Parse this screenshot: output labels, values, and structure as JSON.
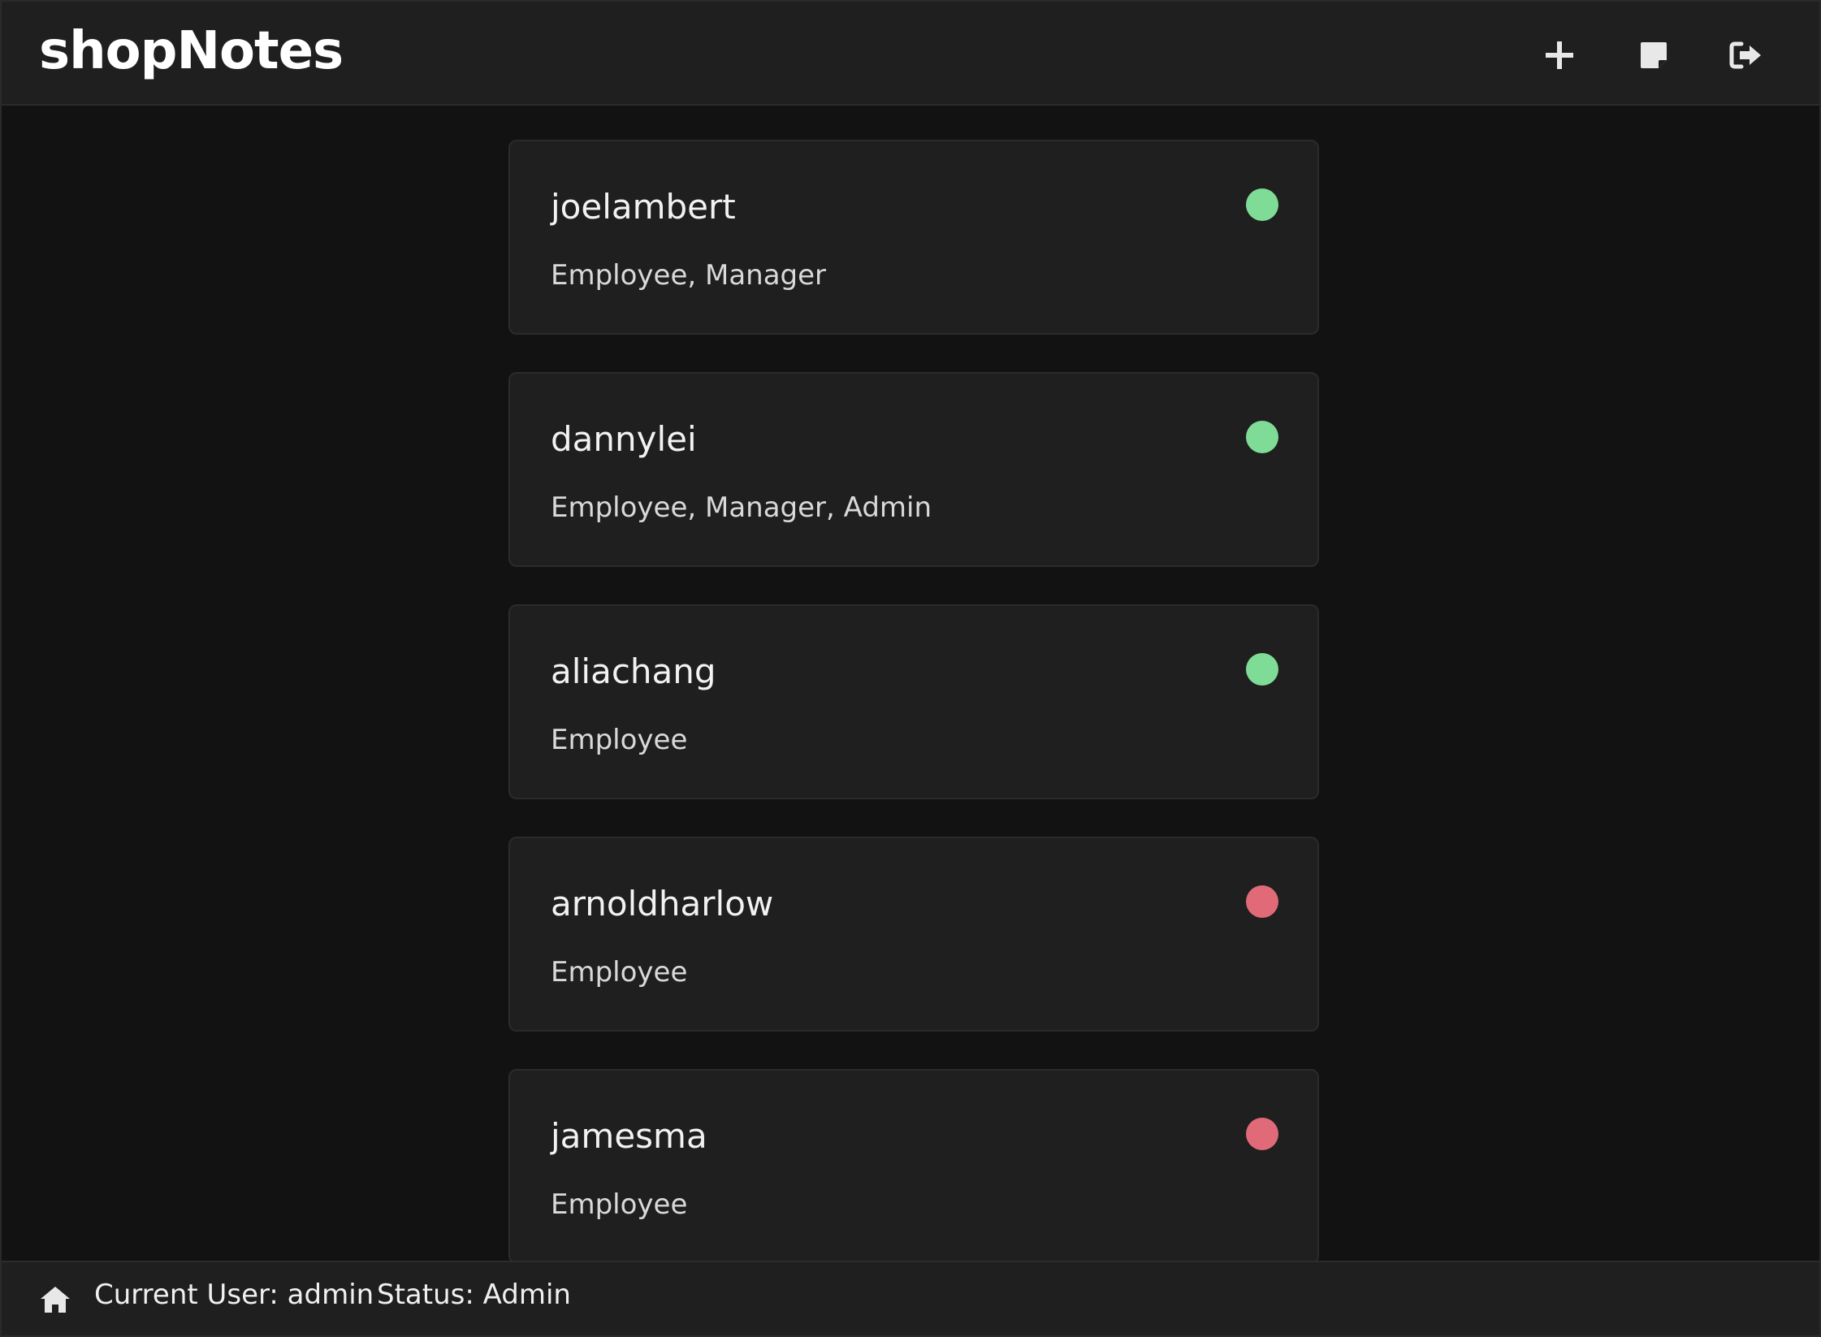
{
  "header": {
    "title": "shopNotes",
    "actions": [
      {
        "icon": "plus-icon",
        "name": "add-user-button"
      },
      {
        "icon": "note-icon",
        "name": "notes-button"
      },
      {
        "icon": "logout-icon",
        "name": "logout-button"
      }
    ]
  },
  "users": [
    {
      "username": "joelambert",
      "roles": "Employee, Manager",
      "status": "active",
      "status_color": "#7fdc96"
    },
    {
      "username": "dannylei",
      "roles": "Employee, Manager, Admin",
      "status": "active",
      "status_color": "#7fdc96"
    },
    {
      "username": "aliachang",
      "roles": "Employee",
      "status": "active",
      "status_color": "#7fdc96"
    },
    {
      "username": "arnoldharlow",
      "roles": "Employee",
      "status": "inactive",
      "status_color": "#e06a78"
    },
    {
      "username": "jamesma",
      "roles": "Employee",
      "status": "inactive",
      "status_color": "#e06a78"
    }
  ],
  "footer": {
    "home_icon": "home-icon",
    "current_user": "Current User: admin",
    "status": "Status: Admin"
  },
  "colors": {
    "background": "#121212",
    "panel": "#1f1f1f",
    "active": "#7fdc96",
    "inactive": "#e06a78"
  }
}
